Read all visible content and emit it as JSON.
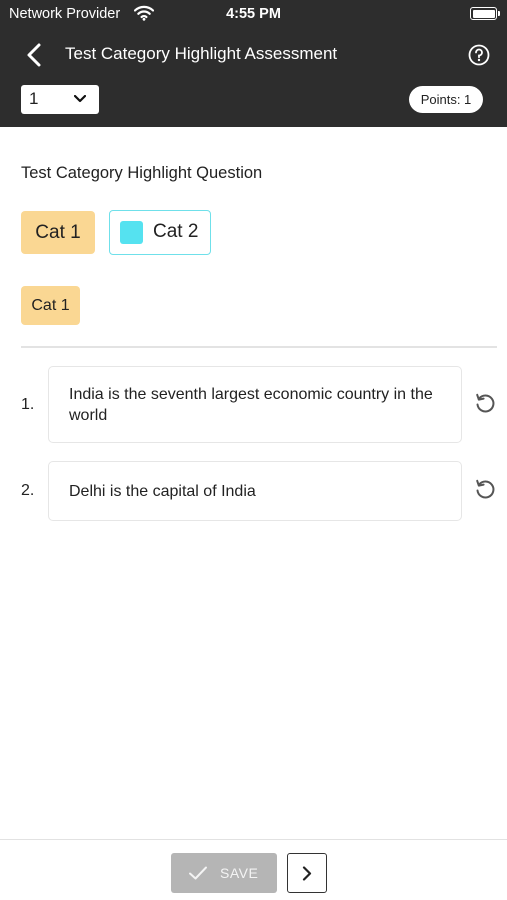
{
  "status_bar": {
    "carrier": "Network Provider",
    "time": "4:55 PM",
    "wifi_icon": "wifi-icon",
    "battery_icon": "battery-icon"
  },
  "header": {
    "title": "Test Category Highlight Assessment",
    "back_icon": "chevron-left-icon",
    "help_icon": "help-circle-icon",
    "question_selector": {
      "selected": "1"
    },
    "points": "Points: 1",
    "background_color": "#2d2d2d"
  },
  "question": {
    "text": "Test Category Highlight Question"
  },
  "categories": [
    {
      "label": "Cat 1",
      "color": "#fad793"
    },
    {
      "label": "Cat 2",
      "color": "#55e2f0",
      "border_color": "#6fe0ea"
    }
  ],
  "selected_category_tag": "Cat 1",
  "items": [
    {
      "number": "1.",
      "text": "India is the seventh largest economic country in the world",
      "reset_icon": "reset-icon"
    },
    {
      "number": "2.",
      "text": "Delhi is the capital of India",
      "reset_icon": "reset-icon"
    }
  ],
  "footer": {
    "save_label": "SAVE",
    "save_icon": "check-icon",
    "next_icon": "chevron-right-icon"
  }
}
